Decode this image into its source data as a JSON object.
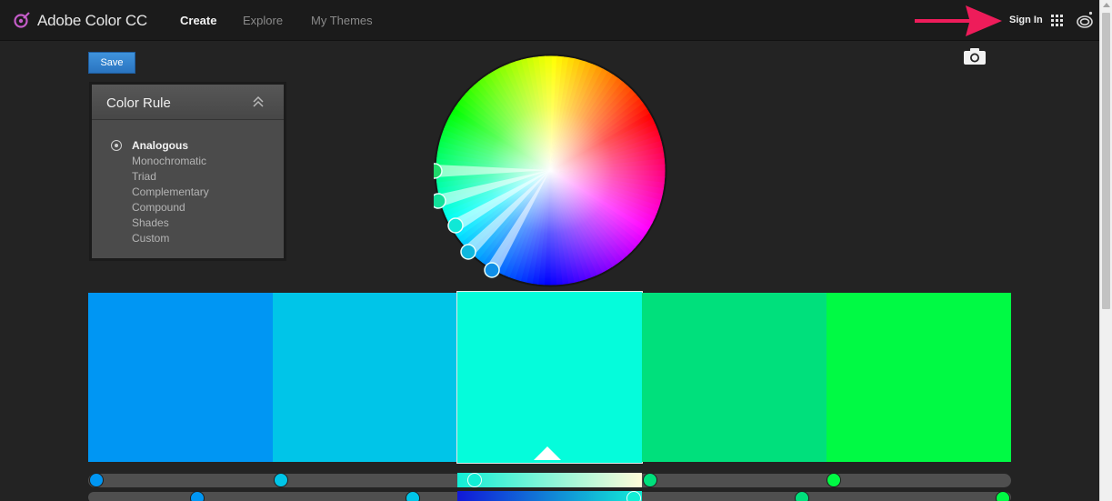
{
  "app": {
    "title": "Adobe Color CC"
  },
  "nav": [
    {
      "label": "Create",
      "active": true
    },
    {
      "label": "Explore",
      "active": false
    },
    {
      "label": "My Themes",
      "active": false
    }
  ],
  "header": {
    "sign_in": "Sign In"
  },
  "toolbar": {
    "save_label": "Save"
  },
  "color_rule": {
    "title": "Color Rule",
    "selected": "Analogous",
    "options": [
      "Analogous",
      "Monochromatic",
      "Triad",
      "Complementary",
      "Compound",
      "Shades",
      "Custom"
    ]
  },
  "swatches": {
    "colors": [
      "#0096f3",
      "#00c5e8",
      "#05fcdb",
      "#00e07c",
      "#00fa44"
    ],
    "selected_index": 2
  },
  "colors": {
    "accent": "#2f80cc",
    "annotation_arrow": "#ee1c5a",
    "background": "#232323"
  },
  "icons": [
    "adobe-color-logo-icon",
    "apps-grid-icon",
    "creative-cloud-icon",
    "camera-icon",
    "chevron-up-double-icon",
    "annotation-arrow-icon"
  ]
}
